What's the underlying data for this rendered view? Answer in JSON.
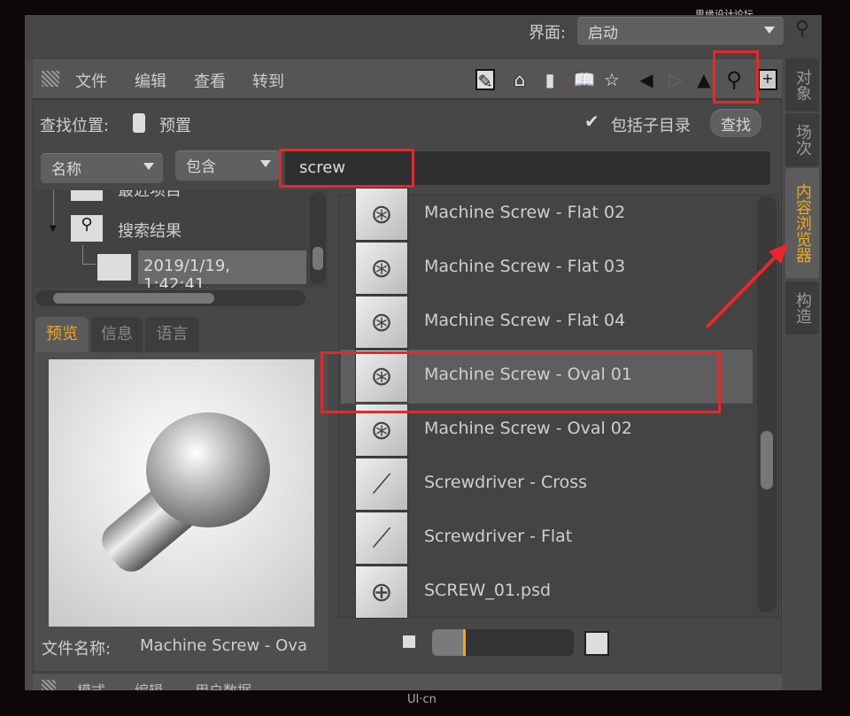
{
  "watermark_top": "思缘设计论坛 WWW.MISSYUAN.COM",
  "watermark_bottom": "UI·cn",
  "topbar": {
    "label": "界面:",
    "layout_value": "启动"
  },
  "menu": {
    "items": [
      "文件",
      "编辑",
      "查看",
      "转到"
    ]
  },
  "toolbar_icons": [
    "edit-icon",
    "home-icon",
    "bottle-icon",
    "book-icon",
    "star-icon",
    "back-icon",
    "forward-icon",
    "cursor-icon",
    "search-icon",
    "add-pane-icon"
  ],
  "search_location": {
    "label": "查找位置:",
    "value": "预置",
    "include_subdirs_label": "包括子目录",
    "include_subdirs_checked": true,
    "search_button": "查找"
  },
  "filter": {
    "field": "名称",
    "operator": "包含",
    "query": "screw"
  },
  "tree": {
    "items": [
      {
        "label": "最近项目"
      },
      {
        "label": "搜索结果"
      },
      {
        "label": "2019/1/19, 1:42:41,"
      }
    ]
  },
  "preview_tabs": [
    {
      "label": "预览",
      "active": true
    },
    {
      "label": "信息"
    },
    {
      "label": "语言"
    }
  ],
  "file_name": {
    "label": "文件名称:",
    "value": "Machine Screw - Ova"
  },
  "results": [
    {
      "label": "Machine Screw - Flat 02",
      "icon": "screw-icon"
    },
    {
      "label": "Machine Screw - Flat 03",
      "icon": "screw-icon"
    },
    {
      "label": "Machine Screw - Flat 04",
      "icon": "screw-icon"
    },
    {
      "label": "Machine Screw - Oval 01",
      "icon": "screw-icon",
      "selected": true
    },
    {
      "label": "Machine Screw - Oval 02",
      "icon": "screw-icon"
    },
    {
      "label": "Screwdriver - Cross",
      "icon": "screwdriver-icon"
    },
    {
      "label": "Screwdriver - Flat",
      "icon": "screwdriver-icon"
    },
    {
      "label": "SCREW_01.psd",
      "icon": "crosshair-icon"
    }
  ],
  "thumbnail_size_percent": 10,
  "side_tabs": [
    {
      "label": "对象"
    },
    {
      "label": "场次"
    },
    {
      "label": "内容浏览器",
      "active": true
    },
    {
      "label": "构造"
    }
  ],
  "bottom_panel_menu": [
    "模式",
    "编辑",
    "用户数据"
  ],
  "colors": {
    "accent": "#f0a81e",
    "annotation": "#e8272b",
    "background": "#4a4a4a"
  }
}
